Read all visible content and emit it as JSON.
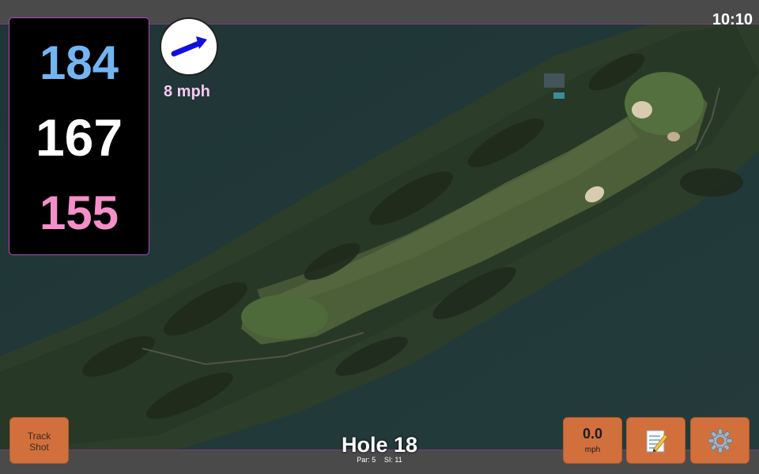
{
  "status": {
    "time": "10:10"
  },
  "distances": {
    "back": "184",
    "middle": "167",
    "front": "155"
  },
  "wind": {
    "speed": "8 mph",
    "icon": "wind-arrow-icon",
    "arrow_color": "#1010e0"
  },
  "buttons": {
    "track_shot_label": "Track Shot",
    "speed_value": "0.0",
    "speed_unit": "mph",
    "notes_icon": "notepad-icon",
    "settings_icon": "gear-icon"
  },
  "hole": {
    "title": "Hole 18",
    "par": "Par: 5",
    "si": "SI: 11"
  },
  "colors": {
    "back": "#72b5f2",
    "middle": "#ffffff",
    "front": "#f48fc8",
    "button": "#d2703d",
    "panel_border": "#b24bb8"
  }
}
